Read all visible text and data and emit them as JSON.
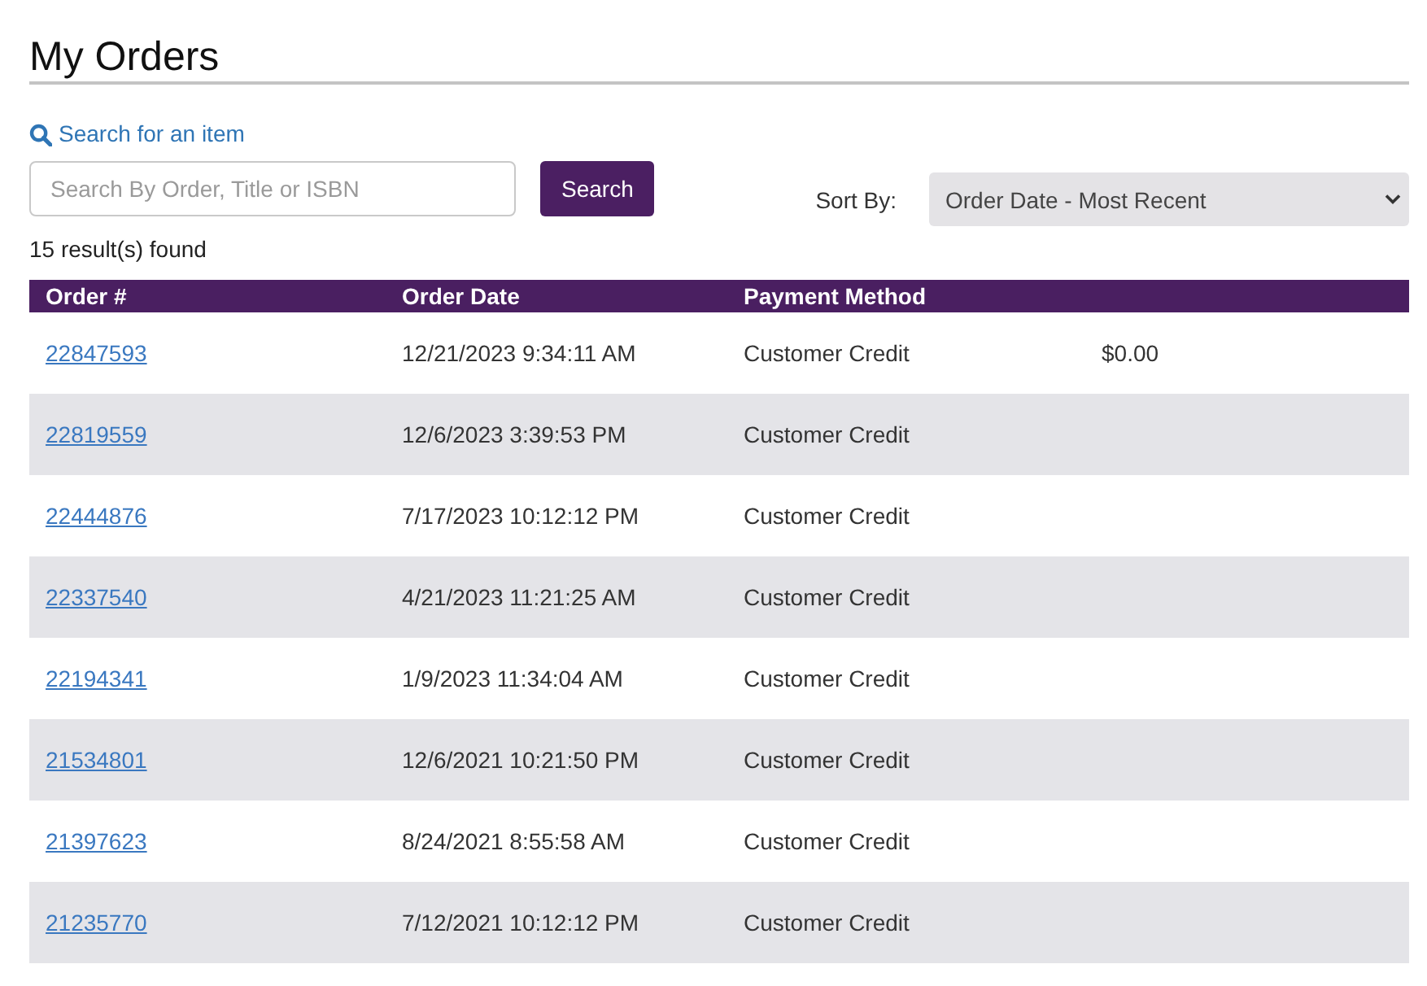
{
  "page": {
    "title": "My Orders"
  },
  "search": {
    "link": "Search for an item",
    "placeholder": "Search By Order, Title or ISBN",
    "button": "Search"
  },
  "sort": {
    "label": "Sort By:",
    "value": "Order Date - Most Recent"
  },
  "results": "15 result(s) found",
  "table": {
    "columns": [
      "Order #",
      "Order Date",
      "Payment Method"
    ],
    "rows": [
      {
        "order": "22847593",
        "date": "12/21/2023 9:34:11 AM",
        "payment": "Customer Credit",
        "column_4": "$0.00"
      },
      {
        "order": "22819559",
        "date": "12/6/2023 3:39:53 PM",
        "payment": "Customer Credit"
      },
      {
        "order": "22444876",
        "date": "7/17/2023 10:12:12 PM",
        "payment": "Customer Credit"
      },
      {
        "order": "22337540",
        "date": "4/21/2023 11:21:25 AM",
        "payment": "Customer Credit"
      },
      {
        "order": "22194341",
        "date": "1/9/2023 11:34:04 AM",
        "payment": "Customer Credit"
      },
      {
        "order": "21534801",
        "date": "12/6/2021 10:21:50 PM",
        "payment": "Customer Credit"
      },
      {
        "order": "21397623",
        "date": "8/24/2021 8:55:58 AM",
        "payment": "Customer Credit"
      },
      {
        "order": "21235770",
        "date": "7/12/2021 10:12:12 PM",
        "payment": "Customer Credit"
      }
    ]
  }
}
